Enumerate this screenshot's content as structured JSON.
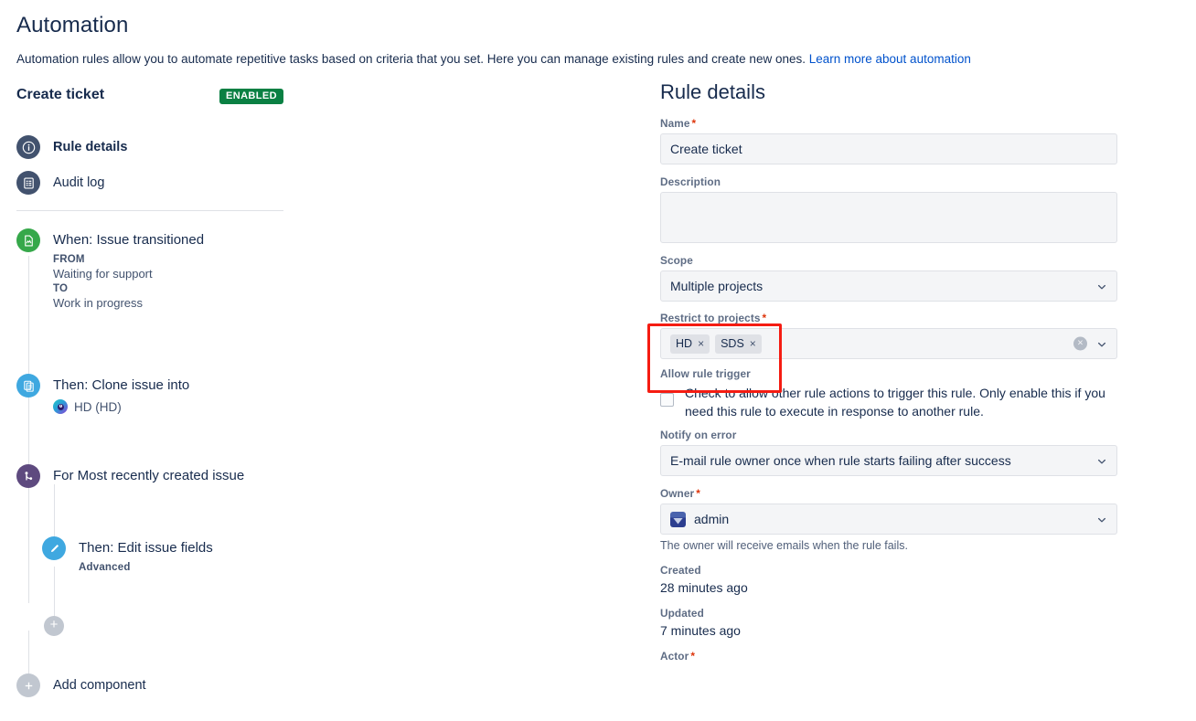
{
  "header": {
    "title": "Automation",
    "description_prefix": "Automation rules allow you to automate repetitive tasks based on criteria that you set. Here you can manage existing rules and create new ones. ",
    "learn_more_link": "Learn more about automation"
  },
  "rule": {
    "name": "Create ticket",
    "status_badge": "ENABLED"
  },
  "nav": {
    "items": [
      {
        "label": "Rule details",
        "icon": "info-circle-icon"
      },
      {
        "label": "Audit log",
        "icon": "document-list-icon"
      }
    ]
  },
  "components": [
    {
      "title": "When: Issue transitioned",
      "icon": "trigger-icon",
      "from_label": "FROM",
      "from_value": "Waiting for support",
      "to_label": "TO",
      "to_value": "Work in progress"
    },
    {
      "title": "Then: Clone issue into",
      "icon": "clone-issue-icon",
      "project": "HD (HD)",
      "project_avatar": "project-avatar-hd"
    },
    {
      "title": "For Most recently created issue",
      "icon": "branch-icon"
    },
    {
      "title": "Then: Edit issue fields",
      "icon": "pencil-icon",
      "subtitle": "Advanced"
    }
  ],
  "add_branch_component_label": "+",
  "add_component": {
    "label": "Add component",
    "icon": "plus-circle-icon"
  },
  "details": {
    "panel_title": "Rule details",
    "name": {
      "label": "Name",
      "required": true,
      "value": "Create ticket"
    },
    "description": {
      "label": "Description",
      "required": false,
      "value": "",
      "placeholder": ""
    },
    "scope": {
      "label": "Scope",
      "required": false,
      "value": "Multiple projects"
    },
    "restrict_to_projects": {
      "label": "Restrict to projects",
      "required": true,
      "tags": [
        "HD",
        "SDS"
      ],
      "tag_remove_glyph": "×",
      "clear_glyph": "×"
    },
    "allow_rule_trigger": {
      "label": "Allow rule trigger",
      "checkbox_text": "Check to allow other rule actions to trigger this rule. Only enable this if you need this rule to execute in response to another rule.",
      "checked": false
    },
    "notify_on_error": {
      "label": "Notify on error",
      "value": "E-mail rule owner once when rule starts failing after success"
    },
    "owner": {
      "label": "Owner",
      "required": true,
      "value": "admin",
      "help": "The owner will receive emails when the rule fails."
    },
    "created": {
      "label": "Created",
      "value": "28 minutes ago"
    },
    "updated": {
      "label": "Updated",
      "value": "7 minutes ago"
    },
    "actor": {
      "label": "Actor",
      "required": true
    }
  },
  "colors": {
    "link": "#0052cc",
    "badge_green": "#0a8043",
    "required_red": "#de350b",
    "highlight_red": "#f51c12",
    "slate_icon": "#42526e",
    "green_icon": "#36a84a",
    "blue_icon": "#3fa8e0",
    "purple_icon": "#5e4a7f",
    "grey_icon": "#c1c7d0"
  }
}
